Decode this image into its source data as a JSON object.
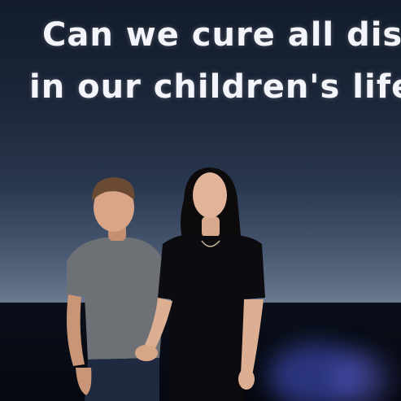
{
  "screen": {
    "line1": "Can we cure all dis",
    "line2": "in our children's life"
  },
  "colors": {
    "screen_text": "#f3f5fb",
    "backdrop_top": "#131c2b",
    "backdrop_bottom": "#6b7990",
    "stage_glow": "#4a5ad6",
    "tshirt": "#6d7175",
    "dress": "#0c0c10"
  }
}
